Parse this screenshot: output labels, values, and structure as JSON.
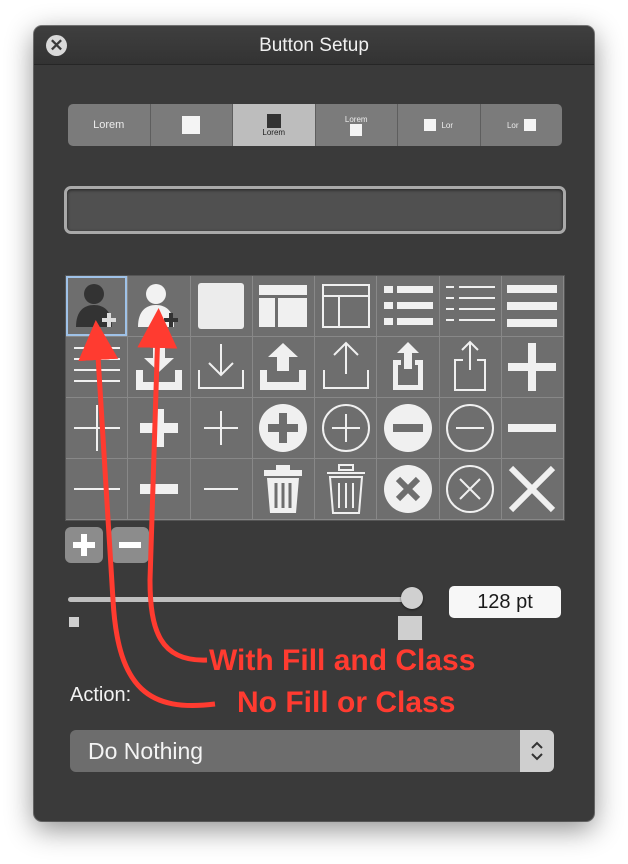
{
  "window": {
    "title": "Button Setup"
  },
  "display_segments": [
    {
      "label": "Lorem",
      "style": "text-only",
      "selected": false
    },
    {
      "label": "",
      "style": "icon-only",
      "selected": false
    },
    {
      "label": "Lorem",
      "style": "icon-above-text",
      "selected": true
    },
    {
      "label": "Lorem",
      "style": "text-above-icon",
      "selected": false
    },
    {
      "label": "Lor",
      "style": "icon-left-text",
      "selected": false
    },
    {
      "label": "Lor",
      "style": "text-left-icon",
      "selected": false
    }
  ],
  "label_field": {
    "value": ""
  },
  "icons": [
    "user-add-filled",
    "user-add-white",
    "square",
    "layout-top-columns-filled",
    "layout-top-columns-outline",
    "list-bullets-filled",
    "list-bullets-outline",
    "menu-lines-thick",
    "menu-lines-thin",
    "download-tray-filled",
    "download-tray-outline",
    "upload-tray-filled",
    "upload-tray-outline",
    "share-filled",
    "share-outline",
    "plus-thick",
    "plus-thin",
    "plus-medium",
    "plus-light",
    "plus-circle-filled",
    "plus-circle-outline",
    "minus-circle-filled",
    "minus-circle-outline",
    "minus-thick",
    "minus-thin",
    "minus-medium",
    "minus-light",
    "trash-filled",
    "trash-outline",
    "x-circle-filled",
    "x-circle-outline",
    "x-thick"
  ],
  "selected_icon_index": 0,
  "controls": {
    "add": "+",
    "remove": "−"
  },
  "size": {
    "value_label": "128 pt",
    "level": 1.0
  },
  "action": {
    "label": "Action:",
    "selected": "Do Nothing"
  },
  "annotations": [
    {
      "text": "With Fill and Class",
      "color": "#ff3b30"
    },
    {
      "text": "No Fill or Class",
      "color": "#ff3b30"
    }
  ]
}
